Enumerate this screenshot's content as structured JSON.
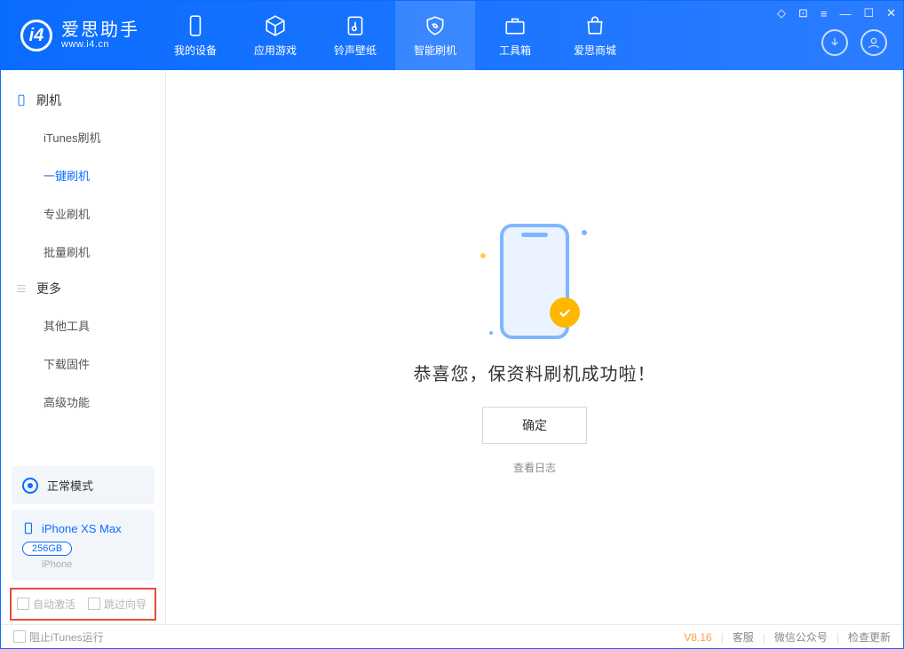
{
  "app": {
    "name": "爱思助手",
    "domain": "www.i4.cn"
  },
  "nav": {
    "device": "我的设备",
    "apps": "应用游戏",
    "ringtones": "铃声壁纸",
    "flash": "智能刷机",
    "toolbox": "工具箱",
    "store": "爱思商城"
  },
  "sidebar": {
    "group_flash": "刷机",
    "sub_itunes": "iTunes刷机",
    "sub_oneclick": "一键刷机",
    "sub_pro": "专业刷机",
    "sub_batch": "批量刷机",
    "group_more": "更多",
    "sub_othertools": "其他工具",
    "sub_download": "下载固件",
    "sub_advanced": "高级功能"
  },
  "mode": {
    "label": "正常模式"
  },
  "device": {
    "name": "iPhone XS Max",
    "storage": "256GB",
    "type": "iPhone"
  },
  "options": {
    "auto_activate": "自动激活",
    "skip_guide": "跳过向导"
  },
  "main": {
    "success": "恭喜您，保资料刷机成功啦！",
    "ok": "确定",
    "view_log": "查看日志"
  },
  "footer": {
    "block_itunes": "阻止iTunes运行",
    "version": "V8.16",
    "support": "客服",
    "wechat": "微信公众号",
    "update": "检查更新"
  }
}
